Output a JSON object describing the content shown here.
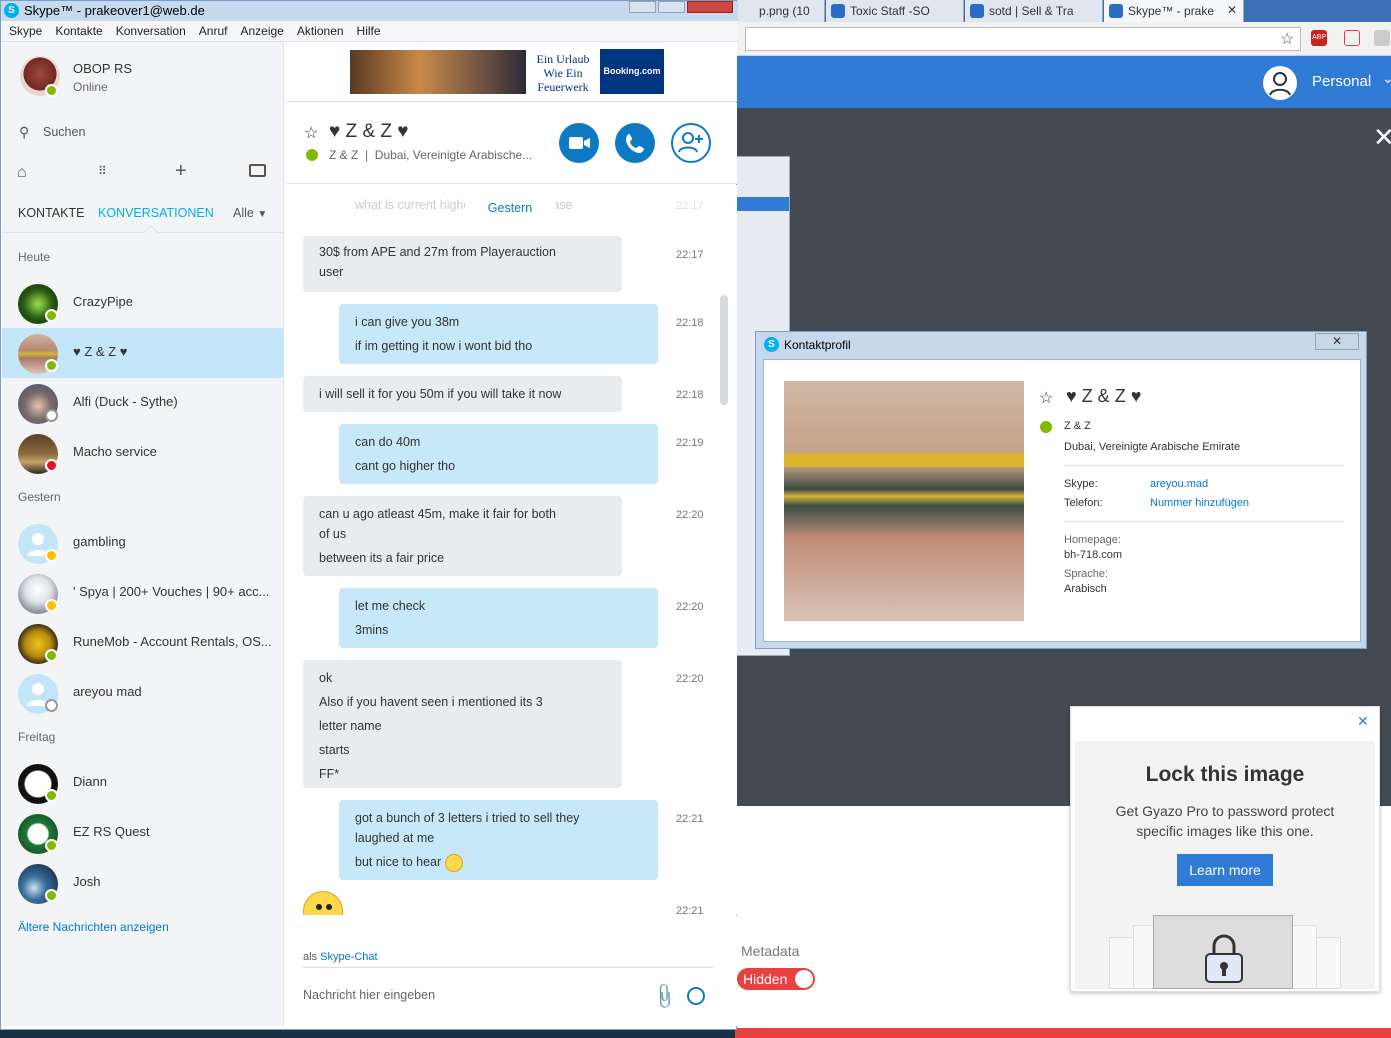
{
  "skype": {
    "window_title": "Skype™ - prakeover1@web.de",
    "menu": [
      "Skype",
      "Kontakte",
      "Konversation",
      "Anruf",
      "Anzeige",
      "Aktionen",
      "Hilfe"
    ],
    "profile": {
      "name": "OBOP RS",
      "status": "Online"
    },
    "search_placeholder": "Suchen",
    "tabs": {
      "contacts": "KONTAKTE",
      "conversations": "KONVERSATIONEN",
      "filter": "Alle"
    },
    "sections": {
      "today": "Heute",
      "yesterday": "Gestern",
      "friday": "Freitag"
    },
    "contacts": [
      {
        "name": "CrazyPipe",
        "status": "online"
      },
      {
        "name": "♥ Z & Z ♥",
        "status": "online"
      },
      {
        "name": "Alfi (Duck - Sythe)",
        "status": "offline"
      },
      {
        "name": "Macho service",
        "status": "dnd"
      },
      {
        "name": "gambling",
        "status": "away"
      },
      {
        "name": "' Spya | 200+ Vouches | 90+ acc...",
        "status": "away"
      },
      {
        "name": "RuneMob - Account Rentals, OS...",
        "status": "online"
      },
      {
        "name": "areyou mad",
        "status": "offline"
      },
      {
        "name": "Diann",
        "status": "online"
      },
      {
        "name": "EZ RS Quest",
        "status": "online"
      },
      {
        "name": "Josh",
        "status": "online"
      }
    ],
    "older_link": "Ältere Nachrichten anzeigen",
    "ad": {
      "text_lines": [
        "Ein Urlaub",
        "Wie Ein",
        "Feuerwerk"
      ],
      "brand": "Booking.com"
    },
    "chat": {
      "title": "♥ Z & Z ♥",
      "subtitle": "Z & Z  |  Dubai, Vereinigte Arabische...",
      "faded_text": "what is current highest bid proof please",
      "faded_time": "22:17",
      "date_separator": "Gestern",
      "messages": [
        {
          "dir": "in",
          "lines": [
            "30$ from APE and 27m from Playerauction",
            "user"
          ],
          "time": "22:17"
        },
        {
          "dir": "out",
          "lines": [
            "i can give you 38m",
            "if im getting it now i wont bid tho"
          ],
          "time": "22:18"
        },
        {
          "dir": "in",
          "lines": [
            "i will sell it for you 50m if you will take it now"
          ],
          "time": "22:18"
        },
        {
          "dir": "out",
          "lines": [
            "can do 40m",
            "cant go higher tho"
          ],
          "time": "22:19"
        },
        {
          "dir": "in",
          "lines": [
            "can u ago atleast 45m, make it fair for both",
            "of us",
            "between its a fair price"
          ],
          "time": "22:20"
        },
        {
          "dir": "out",
          "lines": [
            "let me check",
            "3mins"
          ],
          "time": "22:20"
        },
        {
          "dir": "in",
          "lines": [
            "ok",
            "Also if you havent seen i mentioned its 3",
            "letter name",
            "starts",
            "FF*"
          ],
          "time": "22:20"
        },
        {
          "dir": "out",
          "lines": [
            "got a bunch of 3 letters i tried to sell they",
            "laughed at me",
            "but nice to hear"
          ],
          "time": "22:21"
        }
      ],
      "last_time": "22:21",
      "as_label": "als",
      "as_link": "Skype-Chat",
      "input_placeholder": "Nachricht hier eingeben"
    }
  },
  "browser": {
    "tabs": [
      "p.png (10",
      "Toxic Staff -SO",
      "sotd | Sell & Tra",
      "Skype™ - prake"
    ],
    "user_label": "Personal",
    "metadata_label": "Metadata",
    "hidden_label": "Hidden"
  },
  "profile_window": {
    "title": "Kontaktprofil",
    "name": "♥ Z & Z ♥",
    "display": "Z & Z",
    "location": "Dubai, Vereinigte Arabische Emirate",
    "skype_label": "Skype:",
    "skype_value": "areyou.mad",
    "phone_label": "Telefon:",
    "phone_value": "Nummer hinzufügen",
    "homepage_label": "Homepage:",
    "homepage_value": "bh-718.com",
    "language_label": "Sprache:",
    "language_value": "Arabisch"
  },
  "gyazo_popup": {
    "title": "Lock this image",
    "body": "Get Gyazo Pro to password protect specific images like this one.",
    "button": "Learn more"
  }
}
